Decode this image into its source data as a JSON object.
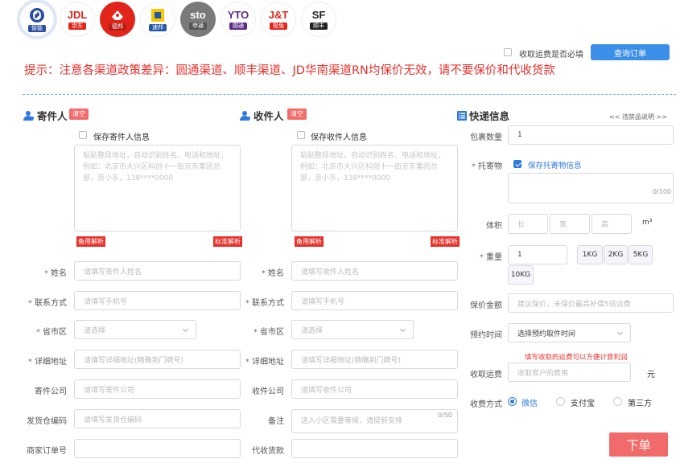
{
  "carriers": [
    {
      "logo": "",
      "tag": "智能",
      "color": "#2b4ea2",
      "bg": "#ffffff",
      "tag_bg": "#2b4ea2",
      "icon": "smart-icon"
    },
    {
      "logo": "JDL",
      "tag": "京东",
      "color": "#e1251b",
      "bg": "#ffffff",
      "tag_bg": "#e1251b"
    },
    {
      "logo": "",
      "tag": "德邦",
      "color": "#e1251b",
      "bg": "#e1251b",
      "tag_bg": "#b81d14",
      "icon": "debang-icon"
    },
    {
      "logo": "",
      "tag": "速邦",
      "color": "#2358a8",
      "bg": "#ffffff",
      "tag_bg": "#2358a8",
      "icon": "subang-icon"
    },
    {
      "logo": "sto",
      "tag": "申通",
      "color": "#ffffff",
      "bg": "#7a7a7a",
      "tag_bg": "#555555"
    },
    {
      "logo": "YTO",
      "tag": "圆通",
      "color": "#5b2a86",
      "bg": "#ffffff",
      "tag_bg": "#5b2a86"
    },
    {
      "logo": "J&T",
      "tag": "极兔",
      "color": "#e1251b",
      "bg": "#ffffff",
      "tag_bg": "#e1251b"
    },
    {
      "logo": "SF",
      "tag": "顺丰",
      "color": "#222222",
      "bg": "#ffffff",
      "tag_bg": "#222222"
    }
  ],
  "top": {
    "fee_required_label": "收取运费是否必填",
    "query_order_button": "查询订单"
  },
  "notice": "提示：注意各渠道政策差异：圆通渠道、顺丰渠道、JD华南渠道RN均保价无效，请不要保价和代收货款",
  "sender": {
    "title": "寄件人",
    "clear": "清空",
    "save_info": "保存寄件人信息",
    "address_placeholder": "粘贴整段地址，自动识别姓名、电话和地址，例如：北京市大兴区科创十一街京东集团总部，京小东，138****0000",
    "backup_parse": "备用解析",
    "standard_parse": "标准解析",
    "fields": {
      "name": {
        "label": "姓名",
        "placeholder": "请填写寄件人姓名"
      },
      "phone": {
        "label": "联系方式",
        "placeholder": "请填写手机号"
      },
      "region": {
        "label": "省市区",
        "placeholder": "请选择"
      },
      "address": {
        "label": "详细地址",
        "placeholder": "请填写详细地址(精确到门牌号)"
      },
      "company": {
        "label": "寄件公司",
        "placeholder": "请填写寄件公司"
      },
      "warehouse": {
        "label": "发货仓编码",
        "placeholder": "请填写发货仓编码"
      },
      "merchant_order": {
        "label": "商家订单号",
        "placeholder": ""
      }
    }
  },
  "receiver": {
    "title": "收件人",
    "clear": "清空",
    "save_info": "保存收件人信息",
    "address_placeholder": "粘贴整段地址，自动识别姓名、电话和地址，例如：北京市大兴区科创十一街京东集团总部，京小东，138****0000",
    "backup_parse": "备用解析",
    "standard_parse": "标准解析",
    "fields": {
      "name": {
        "label": "姓名",
        "placeholder": "请填写收件人姓名"
      },
      "phone": {
        "label": "联系方式",
        "placeholder": "请填写手机号"
      },
      "region": {
        "label": "省市区",
        "placeholder": "请选择"
      },
      "address": {
        "label": "详细地址",
        "placeholder": "请填写详细地址(精确到门牌号)"
      },
      "company": {
        "label": "收件公司",
        "placeholder": "请填写收件公司"
      },
      "remark": {
        "label": "备注",
        "placeholder": "送入小区需要等候，请提前安排",
        "count": "0/50"
      },
      "cod": {
        "label": "代收货款",
        "placeholder": ""
      }
    }
  },
  "express": {
    "title": "快递信息",
    "prohibited_link": "<< 违禁品说明 >>",
    "package_count": {
      "label": "包裹数量",
      "value": "1"
    },
    "goods": {
      "label": "托寄物",
      "save_label": "保存托寄物信息",
      "count": "0/100"
    },
    "volume": {
      "label": "体积",
      "length": "长",
      "width": "宽",
      "height": "高",
      "unit": "m³"
    },
    "weight": {
      "label": "重量",
      "value": "1",
      "presets": [
        "1KG",
        "2KG",
        "5KG",
        "10KG"
      ]
    },
    "insured": {
      "label": "保价金额",
      "placeholder": "建议保价，未保价最高补偿5倍运费"
    },
    "pickup_time": {
      "label": "预约时间",
      "placeholder": "选择预约取件时间"
    },
    "fee_hint": "填写收取的运费可以方便计算利润",
    "fee": {
      "label": "收取运费",
      "placeholder": "收取客户的费用",
      "unit": "元"
    },
    "payment": {
      "label": "收费方式",
      "options": [
        "微信",
        "支付宝",
        "第三方"
      ],
      "selected": "微信"
    },
    "submit": "下单"
  }
}
